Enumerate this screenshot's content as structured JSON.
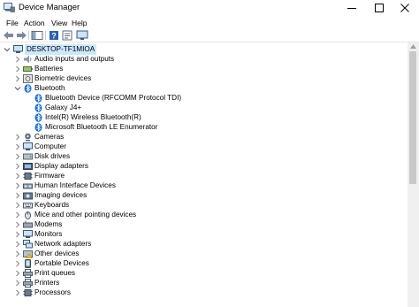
{
  "window": {
    "title": "Device Manager",
    "controls": [
      "minimize",
      "maximize",
      "close"
    ]
  },
  "menu": [
    {
      "label": "File"
    },
    {
      "label": "Action"
    },
    {
      "label": "View"
    },
    {
      "label": "Help"
    }
  ],
  "toolbar": {
    "buttons": [
      "back-icon",
      "forward-icon",
      "show-hide-console-tree-icon",
      "help-icon",
      "properties-icon",
      "monitor-icon"
    ]
  },
  "tree": {
    "root": {
      "label": "DESKTOP-TF1MIOA",
      "icon": "computer-icon",
      "expanded": true,
      "selected": true
    },
    "items": [
      {
        "label": "Audio inputs and outputs",
        "icon": "speaker-icon",
        "expanded": false,
        "level": 1
      },
      {
        "label": "Batteries",
        "icon": "battery-icon",
        "expanded": false,
        "level": 1
      },
      {
        "label": "Biometric devices",
        "icon": "biometric-icon",
        "expanded": false,
        "level": 1
      },
      {
        "label": "Bluetooth",
        "icon": "bluetooth-icon",
        "expanded": true,
        "level": 1
      },
      {
        "label": "Bluetooth Device (RFCOMM Protocol TDI)",
        "icon": "bluetooth-icon",
        "level": 2
      },
      {
        "label": "Galaxy J4+",
        "icon": "bluetooth-icon",
        "level": 2
      },
      {
        "label": "Intel(R) Wireless Bluetooth(R)",
        "icon": "bluetooth-icon",
        "level": 2
      },
      {
        "label": "Microsoft Bluetooth LE Enumerator",
        "icon": "bluetooth-icon",
        "level": 2
      },
      {
        "label": "Cameras",
        "icon": "camera-icon",
        "expanded": false,
        "level": 1
      },
      {
        "label": "Computer",
        "icon": "monitor-icon",
        "expanded": false,
        "level": 1
      },
      {
        "label": "Disk drives",
        "icon": "disk-icon",
        "expanded": false,
        "level": 1
      },
      {
        "label": "Display adapters",
        "icon": "display-adapter-icon",
        "expanded": false,
        "level": 1
      },
      {
        "label": "Firmware",
        "icon": "chip-icon",
        "expanded": false,
        "level": 1
      },
      {
        "label": "Human Interface Devices",
        "icon": "hid-icon",
        "expanded": false,
        "level": 1
      },
      {
        "label": "Imaging devices",
        "icon": "imaging-icon",
        "expanded": false,
        "level": 1
      },
      {
        "label": "Keyboards",
        "icon": "keyboard-icon",
        "expanded": false,
        "level": 1
      },
      {
        "label": "Mice and other pointing devices",
        "icon": "mouse-icon",
        "expanded": false,
        "level": 1
      },
      {
        "label": "Modems",
        "icon": "modem-icon",
        "expanded": false,
        "level": 1
      },
      {
        "label": "Monitors",
        "icon": "monitor-icon",
        "expanded": false,
        "level": 1
      },
      {
        "label": "Network adapters",
        "icon": "network-icon",
        "expanded": false,
        "level": 1
      },
      {
        "label": "Other devices",
        "icon": "other-device-icon",
        "expanded": false,
        "level": 1
      },
      {
        "label": "Portable Devices",
        "icon": "portable-icon",
        "expanded": false,
        "level": 1
      },
      {
        "label": "Print queues",
        "icon": "printer-icon",
        "expanded": false,
        "level": 1
      },
      {
        "label": "Printers",
        "icon": "printer-icon",
        "expanded": false,
        "level": 1
      },
      {
        "label": "Processors",
        "icon": "chip-icon",
        "expanded": false,
        "level": 1
      }
    ]
  },
  "colors": {
    "selection": "#cce8ff",
    "bluetooth": "#1f6fd0",
    "arrow": "#808080"
  }
}
